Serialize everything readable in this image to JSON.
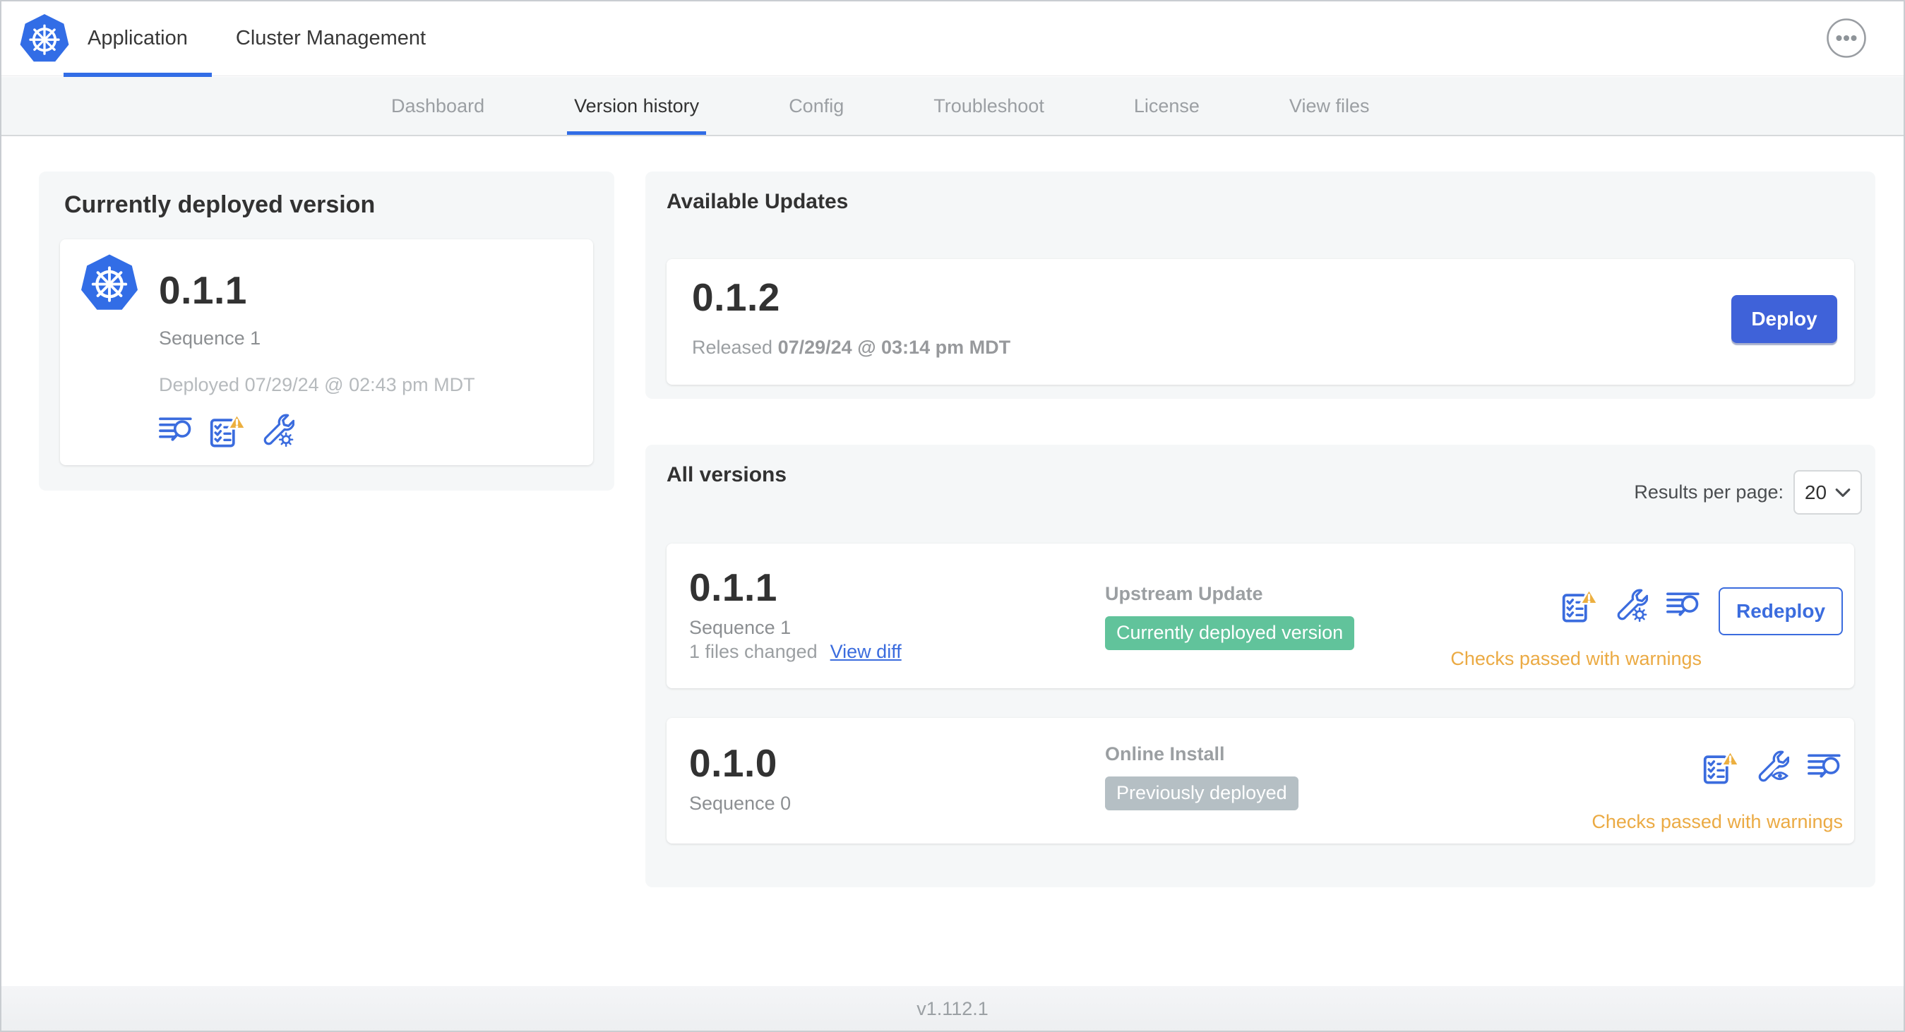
{
  "header": {
    "tabs": [
      {
        "label": "Application",
        "active": true
      },
      {
        "label": "Cluster Management",
        "active": false
      }
    ]
  },
  "subnav": {
    "tabs": [
      {
        "label": "Dashboard",
        "active": false
      },
      {
        "label": "Version history",
        "active": true
      },
      {
        "label": "Config",
        "active": false
      },
      {
        "label": "Troubleshoot",
        "active": false
      },
      {
        "label": "License",
        "active": false
      },
      {
        "label": "View files",
        "active": false
      }
    ]
  },
  "deployed_panel": {
    "title": "Currently deployed version",
    "version": "0.1.1",
    "sequence": "Sequence 1",
    "deployed_at": "Deployed 07/29/24 @ 02:43 pm MDT",
    "icons": [
      "diff-icon",
      "preflight-checks-warning-icon",
      "config-gear-icon"
    ]
  },
  "updates_panel": {
    "title": "Available Updates",
    "update": {
      "version": "0.1.2",
      "released_prefix": "Released",
      "released_date": "07/29/24 @ 03:14 pm MDT",
      "deploy_label": "Deploy"
    }
  },
  "versions_panel": {
    "title": "All versions",
    "results_per_page": {
      "label": "Results per page:",
      "value": "20"
    },
    "rows": [
      {
        "version": "0.1.1",
        "sequence": "Sequence 1",
        "files_changed": "1 files changed",
        "view_diff": "View diff",
        "source": "Upstream Update",
        "badge": "Currently deployed version",
        "badge_color": "#61c39b",
        "status": "Checks passed with warnings",
        "action": "Redeploy",
        "icons": [
          "preflight-checks-warning-icon",
          "config-gear-icon",
          "diff-icon"
        ]
      },
      {
        "version": "0.1.0",
        "sequence": "Sequence 0",
        "source": "Online Install",
        "badge": "Previously deployed",
        "badge_color": "#b5bfc4",
        "status": "Checks passed with warnings",
        "icons": [
          "preflight-checks-warning-icon",
          "config-view-icon",
          "diff-icon"
        ]
      }
    ]
  },
  "footer": {
    "app_version": "v1.112.1"
  },
  "colors": {
    "accent_blue": "#326de6",
    "icon_blue": "#3b6cde",
    "warning_gold": "#ebaa43",
    "badge_green": "#61c39b",
    "badge_gray": "#b5bfc4",
    "panel_bg": "#f5f7f8"
  }
}
